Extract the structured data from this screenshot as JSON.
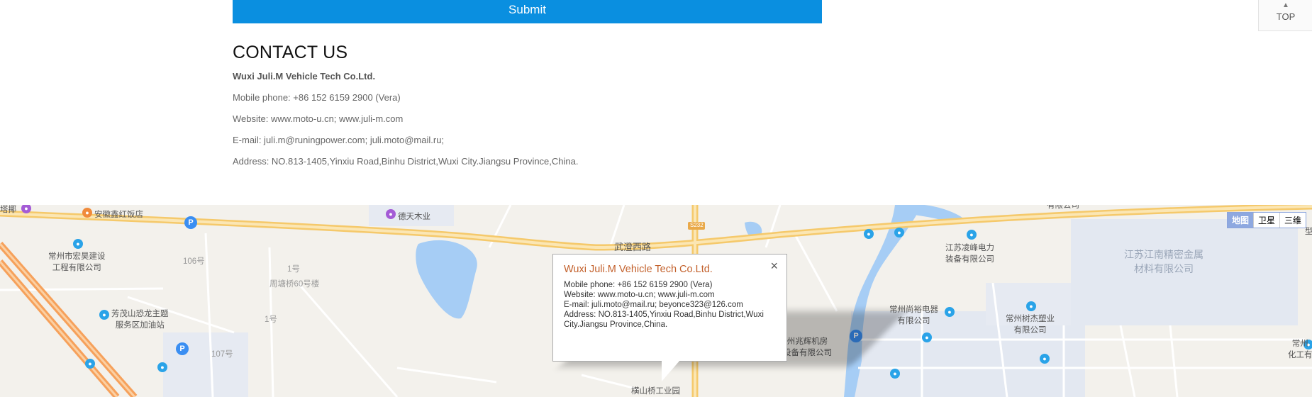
{
  "form": {
    "submit_label": "Submit"
  },
  "top_button": {
    "label": "TOP"
  },
  "contact": {
    "heading": "CONTACT US",
    "company": "Wuxi Juli.M Vehicle Tech Co.Ltd.",
    "phone": "Mobile phone: +86 152 6159 2900 (Vera)",
    "website": "Website: www.moto-u.cn; www.juli-m.com",
    "email": "E-mail: juli.m@runingpower.com; juli.moto@mail.ru;",
    "address": "Address: NO.813-1405,Yinxiu Road,Binhu District,Wuxi City.Jiangsu Province,China."
  },
  "map": {
    "type_buttons": [
      "地图",
      "卫星",
      "三维"
    ],
    "popup": {
      "title": "Wuxi Juli.M Vehicle Tech Co.Ltd.",
      "phone": "Mobile phone: +86 152 6159 2900 (Vera)",
      "website": "Website: www.moto-u.cn; www.juli-m.com",
      "email": "E-mail: juli.moto@mail.ru; beyonce323@126.com",
      "address": "Address: NO.813-1405,Yinxiu Road,Binhu District,Wuxi City.Jiangsu Province,China.",
      "close": "×"
    },
    "labels": {
      "tasao": "塔揶",
      "anhui": "安徽鑫红饭店",
      "detian": "德天木业",
      "changzhou_hongyu_1": "常州市宏昊建设",
      "changzhou_hongyu_2": "工程有限公司",
      "no106": "106号",
      "no1a": "1号",
      "zhoutang": "周塘桥60号楼",
      "fangmao_1": "芳茂山恐龙主题",
      "fangmao_2": "服务区加油站",
      "no1b": "1号",
      "no107": "107号",
      "road": "武澄西路",
      "s232": "S232",
      "hengshanqiao": "横山桥工业园",
      "lingfeng_1": "江苏凌峰电力",
      "lingfeng_2": "装备有限公司",
      "jingmi_1": "江苏江南精密金属",
      "jingmi_2": "材料有限公司",
      "shangyu_1": "常州尚裕电器",
      "shangyu_2": "有限公司",
      "shujie_1": "常州树杰塑业",
      "shujie_2": "有限公司",
      "zhaohui_1": "州兆辉机房",
      "zhaohui_2": "设备有限公司",
      "changzhou_right_1": "常州",
      "changzhou_right_2": "化工有",
      "top_right_partial": "有限公司",
      "far_right": "型"
    }
  }
}
